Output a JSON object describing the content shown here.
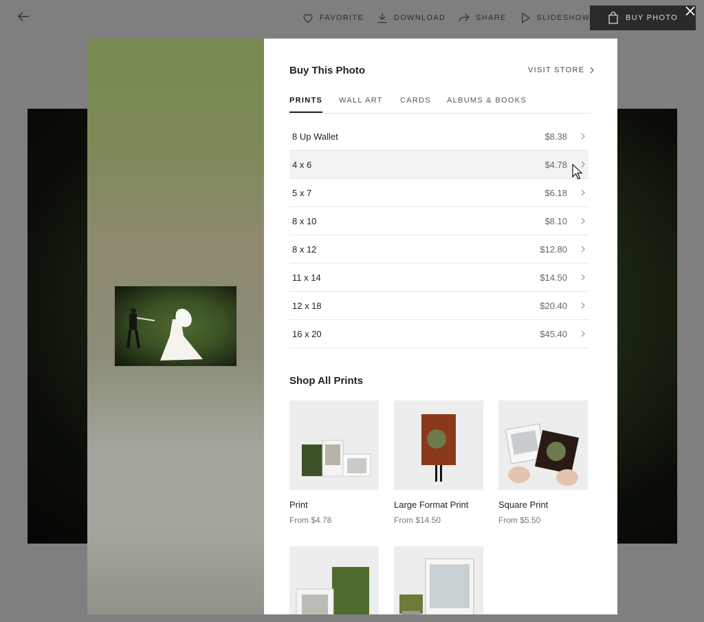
{
  "toolbar": {
    "favorite": "FAVORITE",
    "download": "DOWNLOAD",
    "share": "SHARE",
    "slideshow": "SLIDESHOW",
    "buy_photo": "BUY PHOTO"
  },
  "panel": {
    "title": "Buy This Photo",
    "visit_store": "VISIT STORE",
    "tabs": [
      "PRINTS",
      "WALL ART",
      "CARDS",
      "ALBUMS & BOOKS"
    ],
    "active_tab": "PRINTS",
    "sizes": [
      {
        "name": "8 Up Wallet",
        "price": "$8.38"
      },
      {
        "name": "4 x 6",
        "price": "$4.78"
      },
      {
        "name": "5 x 7",
        "price": "$6.18"
      },
      {
        "name": "8 x 10",
        "price": "$8.10"
      },
      {
        "name": "8 x 12",
        "price": "$12.80"
      },
      {
        "name": "11 x 14",
        "price": "$14.50"
      },
      {
        "name": "12 x 18",
        "price": "$20.40"
      },
      {
        "name": "16 x 20",
        "price": "$45.40"
      }
    ],
    "shop_title": "Shop All Prints",
    "products": [
      {
        "name": "Print",
        "price": "From $4.78"
      },
      {
        "name": "Large Format Print",
        "price": "From $14.50"
      },
      {
        "name": "Square Print",
        "price": "From $5.50"
      }
    ]
  },
  "colors": {
    "overlay": "#7f7f7f",
    "buy_button": "#2a2a2a",
    "panel": "#ffffff",
    "row_hover": "#f3f3f3"
  },
  "icons": [
    "back-arrow-icon",
    "heart-icon",
    "download-icon",
    "share-icon",
    "play-icon",
    "shopping-bag-icon",
    "close-icon",
    "chevron-right-icon",
    "mouse-cursor-icon"
  ]
}
